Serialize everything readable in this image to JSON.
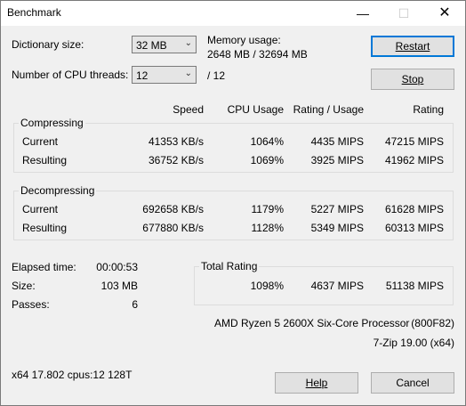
{
  "window": {
    "title": "Benchmark",
    "min": "—",
    "max": "☐",
    "close": "✕"
  },
  "dict": {
    "label": "Dictionary size:",
    "value": "32 MB"
  },
  "threads": {
    "label": "Number of CPU threads:",
    "value": "12",
    "total": "/ 12"
  },
  "memory": {
    "label": "Memory usage:",
    "value": "2648 MB / 32694 MB"
  },
  "buttons": {
    "restart": "Restart",
    "stop": "Stop",
    "help": "Help",
    "cancel": "Cancel"
  },
  "columns": {
    "speed": "Speed",
    "cpu": "CPU Usage",
    "rating_usage": "Rating / Usage",
    "rating": "Rating"
  },
  "compressing": {
    "title": "Compressing",
    "current": {
      "label": "Current",
      "speed": "41353 KB/s",
      "cpu": "1064%",
      "ru": "4435 MIPS",
      "rating": "47215 MIPS"
    },
    "resulting": {
      "label": "Resulting",
      "speed": "36752 KB/s",
      "cpu": "1069%",
      "ru": "3925 MIPS",
      "rating": "41962 MIPS"
    }
  },
  "decompressing": {
    "title": "Decompressing",
    "current": {
      "label": "Current",
      "speed": "692658 KB/s",
      "cpu": "1179%",
      "ru": "5227 MIPS",
      "rating": "61628 MIPS"
    },
    "resulting": {
      "label": "Resulting",
      "speed": "677880 KB/s",
      "cpu": "1128%",
      "ru": "5349 MIPS",
      "rating": "60313 MIPS"
    }
  },
  "stats": {
    "elapsed_label": "Elapsed time:",
    "elapsed": "00:00:53",
    "size_label": "Size:",
    "size": "103 MB",
    "passes_label": "Passes:",
    "passes": "6"
  },
  "total": {
    "title": "Total Rating",
    "cpu": "1098%",
    "ru": "4637 MIPS",
    "rating": "51138 MIPS"
  },
  "cpu_info": {
    "name": "AMD Ryzen 5 2600X Six-Core Processor",
    "id": "(800F82)"
  },
  "version": "7-Zip 19.00 (x64)",
  "sysinfo": "x64 17.802 cpus:12 128T"
}
